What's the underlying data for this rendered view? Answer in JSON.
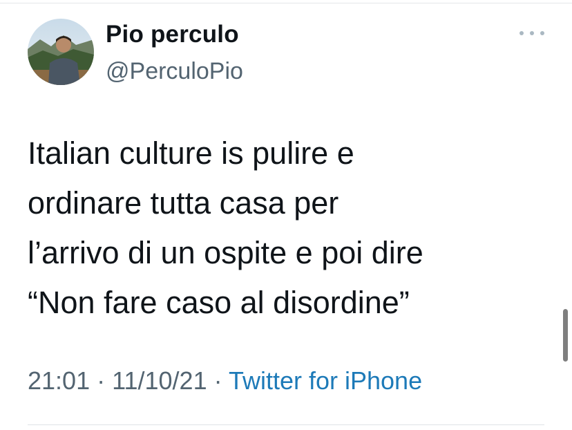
{
  "tweet": {
    "author": {
      "display_name": "Pio perculo",
      "handle": "@PerculoPio"
    },
    "text_lines": [
      "Italian culture is pulire e",
      "ordinare tutta casa per",
      "l’arrivo di un ospite e poi dire",
      "“Non fare caso al disordine”"
    ],
    "time": "21:01",
    "separator": "·",
    "date": "11/10/21",
    "source": "Twitter for iPhone"
  },
  "icons": {
    "more": "more-horizontal-icon",
    "avatar": "profile-avatar"
  },
  "colors": {
    "text": "#0f1419",
    "secondary": "#536471",
    "link": "#1d7ab8"
  }
}
